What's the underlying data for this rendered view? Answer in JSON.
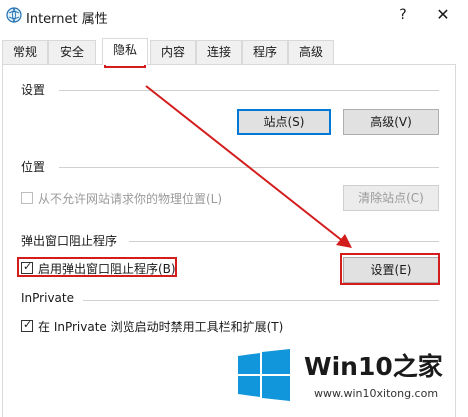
{
  "window": {
    "title": "Internet 属性",
    "help": "?",
    "close": "✕"
  },
  "tabs": [
    {
      "label": "常规"
    },
    {
      "label": "安全"
    },
    {
      "label": "隐私"
    },
    {
      "label": "内容"
    },
    {
      "label": "连接"
    },
    {
      "label": "程序"
    },
    {
      "label": "高级"
    }
  ],
  "active_tab": "隐私",
  "settings": {
    "heading": "设置",
    "sites_button": "站点(S)",
    "advanced_button": "高级(V)"
  },
  "location": {
    "heading": "位置",
    "checkbox_label": "从不允许网站请求你的物理位置(L)",
    "checked": false,
    "clear_button": "清除站点(C)"
  },
  "popup": {
    "heading": "弹出窗口阻止程序",
    "checkbox_label": "启用弹出窗口阻止程序(B)",
    "checked": true,
    "settings_button": "设置(E)"
  },
  "inprivate": {
    "heading": "InPrivate",
    "checkbox_label": "在 InPrivate 浏览启动时禁用工具栏和扩展(T)",
    "checked": true
  },
  "watermark": {
    "brand_prefix": "Win10",
    "brand_suffix": "之家",
    "url": "www.win10xitong.com"
  },
  "colors": {
    "highlight": "#d31c1c",
    "accent": "#0078d7"
  }
}
